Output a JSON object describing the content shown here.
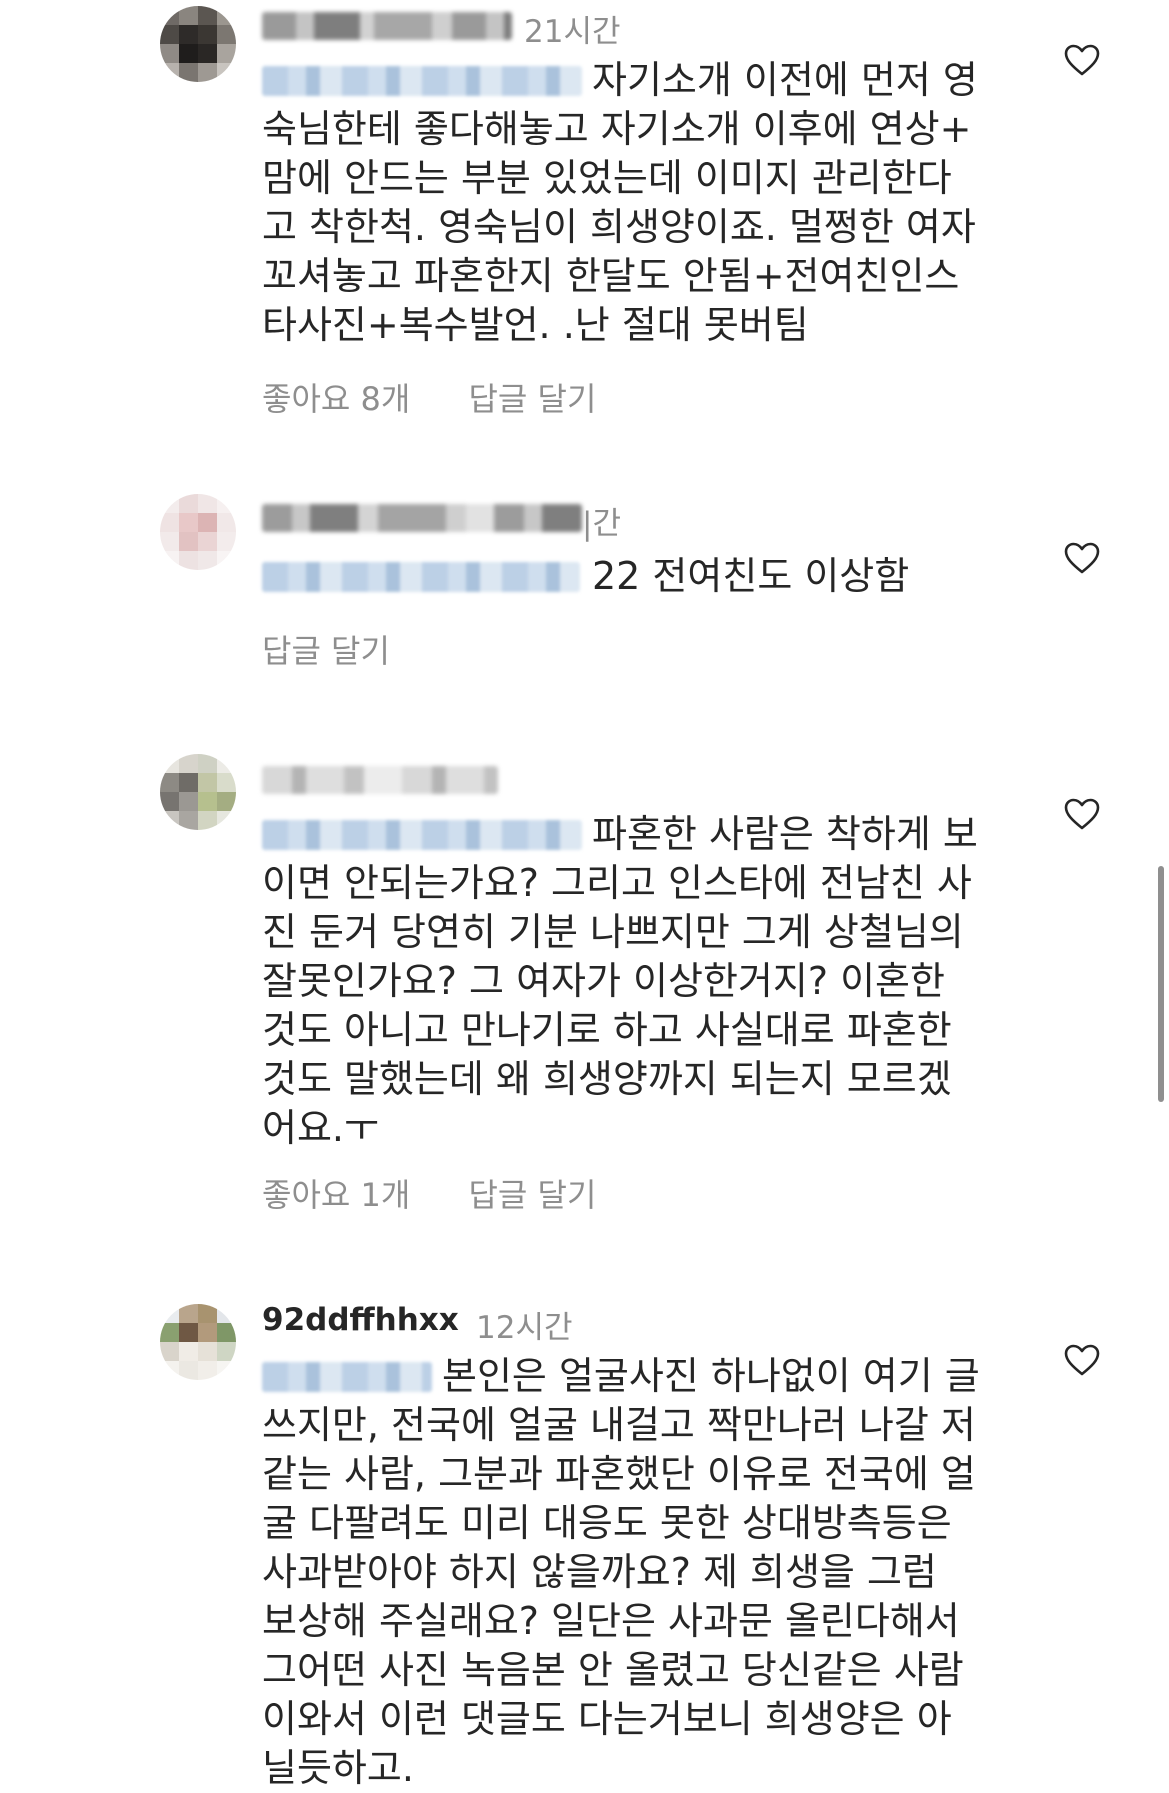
{
  "comments": [
    {
      "time": "21시간",
      "lines": [
        "자기소개 이전에 먼저 영",
        "숙님한테 좋다해놓고 자기소개 이후에 연상+",
        "맘에 안드는 부분 있었는데 이미지 관리한다",
        "고 착한척. 영숙님이 희생양이죠. 멀쩡한 여자",
        "꼬셔놓고 파혼한지 한달도 안됨+전여친인스",
        "타사진+복수발언. .난 절대 못버팀"
      ],
      "likes": "좋아요 8개",
      "reply": "답글 달기"
    },
    {
      "time": "|간",
      "lines": [
        "22 전여친도 이상함"
      ],
      "reply": "답글 달기"
    },
    {
      "lines": [
        "파혼한 사람은 착하게 보",
        "이면 안되는가요? 그리고 인스타에 전남친 사",
        "진 둔거 당연히 기분 나쁘지만 그게 상철님의",
        "잘못인가요? 그 여자가 이상한거지? 이혼한",
        "것도 아니고 만나기로 하고 사실대로 파혼한",
        "것도 말했는데 왜 희생양까지 되는지 모르겠",
        "어요.ㅜ"
      ],
      "likes": "좋아요 1개",
      "reply": "답글 달기"
    },
    {
      "username": "92ddffhhxx",
      "time": "12시간",
      "lines": [
        "본인은 얼굴사진 하나없이 여기 글",
        "쓰지만, 전국에 얼굴 내걸고 짝만나러 나갈 저",
        "같는 사람, 그분과 파혼했단 이유로 전국에 얼",
        "굴 다팔려도 미리 대응도 못한 상대방측등은",
        "사과받아야 하지 않을까요? 제 희생을 그럼",
        "보상해 주실래요? 일단은 사과문 올린다해서",
        "그어떤 사진 녹음본 안 올렸고 당신같은 사람",
        "이와서 이런 댓글도 다는거보니 희생양은 아",
        "닐듯하고."
      ]
    }
  ],
  "icons": {
    "like": "heart-outline-icon"
  },
  "colors": {
    "text": "#262626",
    "meta": "#8e8e8e",
    "mention_blur": "#bcd0e6"
  }
}
